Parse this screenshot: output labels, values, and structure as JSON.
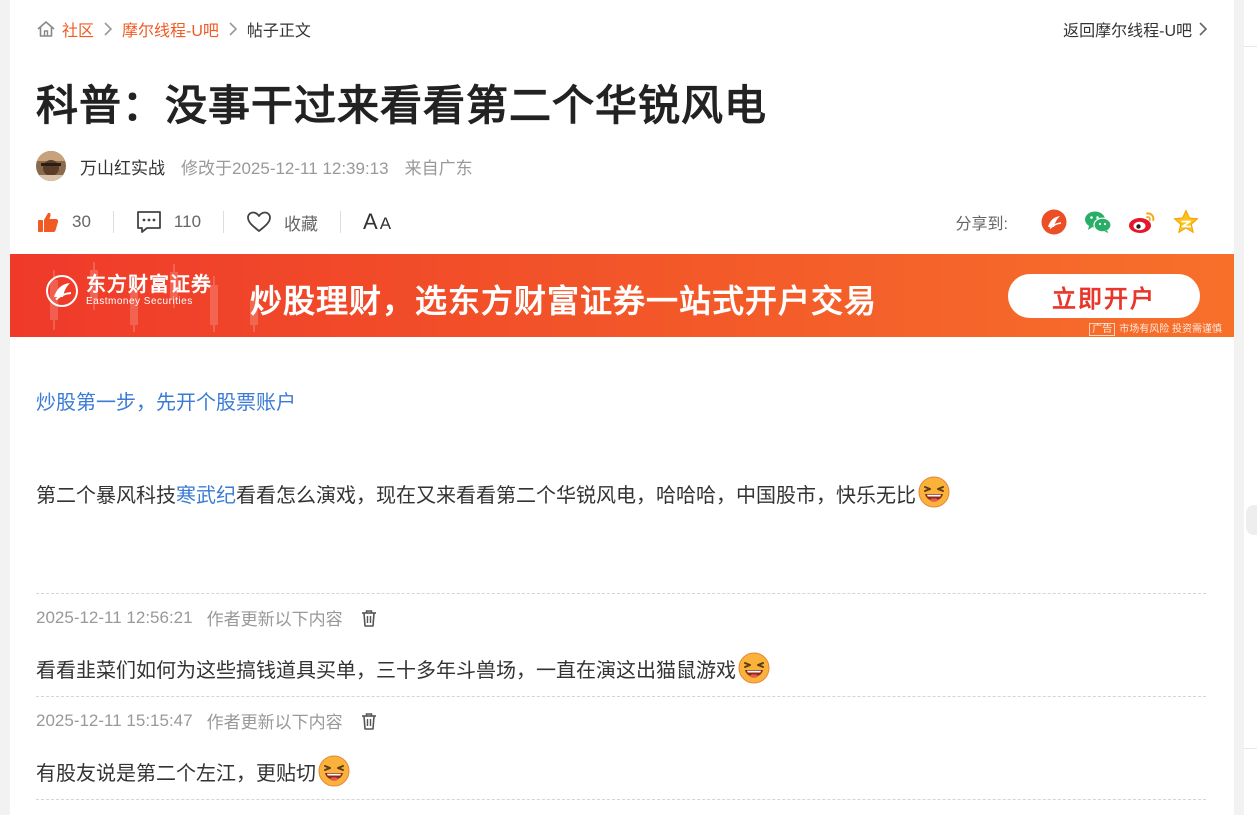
{
  "breadcrumb": {
    "home_icon": "home-icon",
    "items": [
      {
        "label": "社区",
        "link": true
      },
      {
        "label": "摩尔线程-U吧",
        "link": true
      },
      {
        "label": "帖子正文",
        "link": false
      }
    ],
    "back_label": "返回摩尔线程-U吧"
  },
  "post": {
    "title": "科普：没事干过来看看第二个华锐风电",
    "author": "万山红实战",
    "modified": "修改于2025-12-11 12:39:13",
    "location": "来自广东"
  },
  "actions": {
    "likes": "30",
    "comments": "110",
    "favorite_label": "收藏",
    "font_big": "A",
    "font_small": "A"
  },
  "share": {
    "label": "分享到:",
    "targets": [
      "eastmoney-icon",
      "wechat-icon",
      "weibo-icon",
      "qzone-star-icon"
    ]
  },
  "ad": {
    "brand_cn": "东方财富证券",
    "brand_en": "Eastmoney Securities",
    "slogan": "炒股理财，选东方财富证券一站式开户交易",
    "cta": "立即开户",
    "tag": "广告",
    "note": "市场有风险 投资需谨慎"
  },
  "content": {
    "promo_link": "炒股第一步，先开个股票账户",
    "para_before": "第二个暴风科技",
    "para_keyword": "寒武纪",
    "para_after": "看看怎么演戏，现在又来看看第二个华锐风电，哈哈哈，中国股市，快乐无比"
  },
  "updates": [
    {
      "time": "2025-12-11 12:56:21",
      "by": "作者更新以下内容",
      "text": "看看韭菜们如何为这些搞钱道具买单，三十多年斗兽场，一直在演这出猫鼠游戏"
    },
    {
      "time": "2025-12-11 15:15:47",
      "by": "作者更新以下内容",
      "text": "有股友说是第二个左江，更贴切"
    }
  ],
  "colors": {
    "accent": "#f15a22",
    "link": "#3a7bd5",
    "banner": "#f25329"
  }
}
